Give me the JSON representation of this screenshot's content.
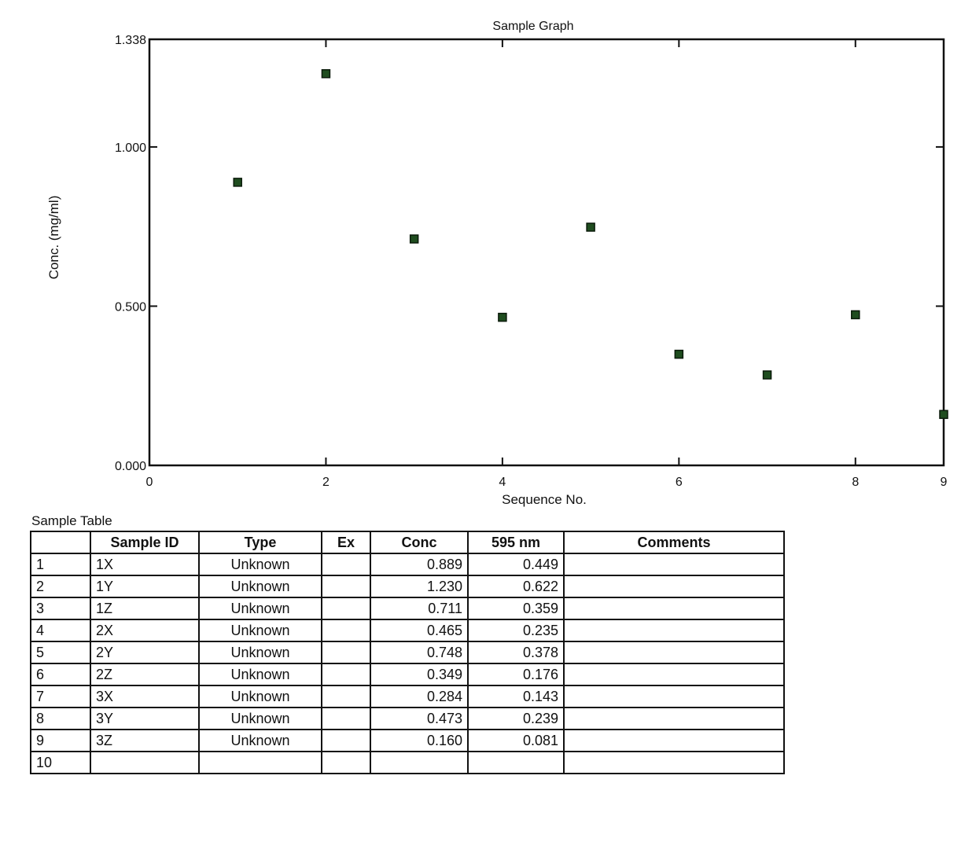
{
  "chart_data": {
    "type": "scatter",
    "title": "Sample Graph",
    "xlabel": "Sequence No.",
    "ylabel": "Conc. (mg/ml)",
    "xlim": [
      0,
      9
    ],
    "ylim": [
      0.0,
      1.338
    ],
    "x_ticks": [
      "0",
      "2",
      "4",
      "6",
      "8",
      "9"
    ],
    "x_tick_values": [
      0,
      2,
      4,
      6,
      8,
      9
    ],
    "y_ticks": [
      "0.000",
      "0.500",
      "1.000",
      "1.338"
    ],
    "y_tick_values": [
      0.0,
      0.5,
      1.0,
      1.338
    ],
    "grid": false,
    "marker_color": "#1f4d1f",
    "points": [
      {
        "x": 1,
        "y": 0.889
      },
      {
        "x": 2,
        "y": 1.23
      },
      {
        "x": 3,
        "y": 0.711
      },
      {
        "x": 4,
        "y": 0.465
      },
      {
        "x": 5,
        "y": 0.748
      },
      {
        "x": 6,
        "y": 0.349
      },
      {
        "x": 7,
        "y": 0.284
      },
      {
        "x": 8,
        "y": 0.473
      },
      {
        "x": 9,
        "y": 0.16
      }
    ]
  },
  "table": {
    "caption": "Sample Table",
    "headers": [
      "",
      "Sample ID",
      "Type",
      "Ex",
      "Conc",
      "595 nm",
      "Comments"
    ],
    "rows": [
      [
        "1",
        "1X",
        "Unknown",
        "",
        "0.889",
        "0.449",
        ""
      ],
      [
        "2",
        "1Y",
        "Unknown",
        "",
        "1.230",
        "0.622",
        ""
      ],
      [
        "3",
        "1Z",
        "Unknown",
        "",
        "0.711",
        "0.359",
        ""
      ],
      [
        "4",
        "2X",
        "Unknown",
        "",
        "0.465",
        "0.235",
        ""
      ],
      [
        "5",
        "2Y",
        "Unknown",
        "",
        "0.748",
        "0.378",
        ""
      ],
      [
        "6",
        "2Z",
        "Unknown",
        "",
        "0.349",
        "0.176",
        ""
      ],
      [
        "7",
        "3X",
        "Unknown",
        "",
        "0.284",
        "0.143",
        ""
      ],
      [
        "8",
        "3Y",
        "Unknown",
        "",
        "0.473",
        "0.239",
        ""
      ],
      [
        "9",
        "3Z",
        "Unknown",
        "",
        "0.160",
        "0.081",
        ""
      ],
      [
        "10",
        "",
        "",
        "",
        "",
        "",
        ""
      ]
    ]
  }
}
